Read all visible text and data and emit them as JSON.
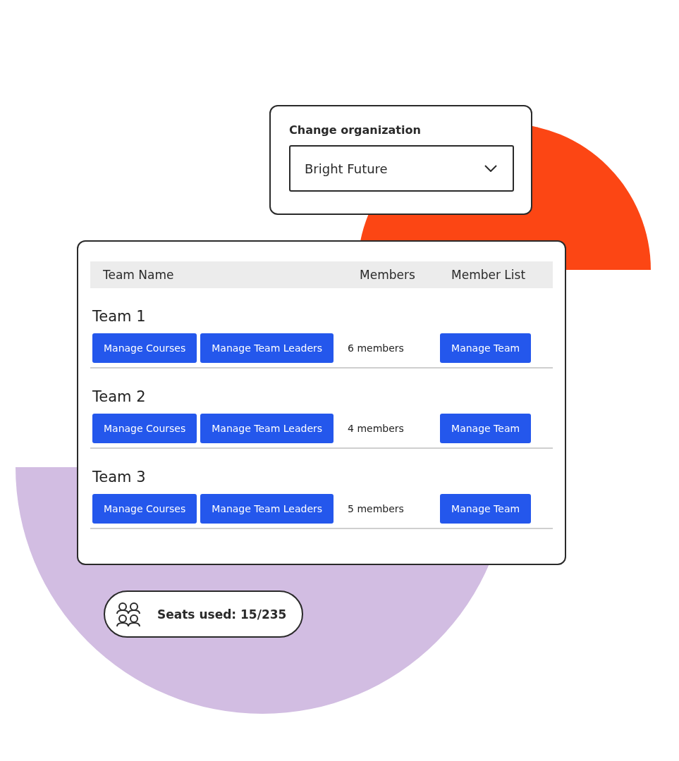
{
  "organization": {
    "label": "Change organization",
    "value": "Bright Future"
  },
  "table": {
    "columns": [
      "Team Name",
      "Members",
      "Member List"
    ],
    "rows": [
      {
        "name": "Team 1",
        "actions": [
          "Manage Courses",
          "Manage Team Leaders"
        ],
        "members": "6 members",
        "member_action": "Manage Team"
      },
      {
        "name": "Team 2",
        "actions": [
          "Manage Courses",
          "Manage Team Leaders"
        ],
        "members": "4 members",
        "member_action": "Manage Team"
      },
      {
        "name": "Team 3",
        "actions": [
          "Manage Courses",
          "Manage Team Leaders"
        ],
        "members": "5 members",
        "member_action": "Manage Team"
      }
    ]
  },
  "seats": {
    "text": "Seats used: 15/235"
  }
}
